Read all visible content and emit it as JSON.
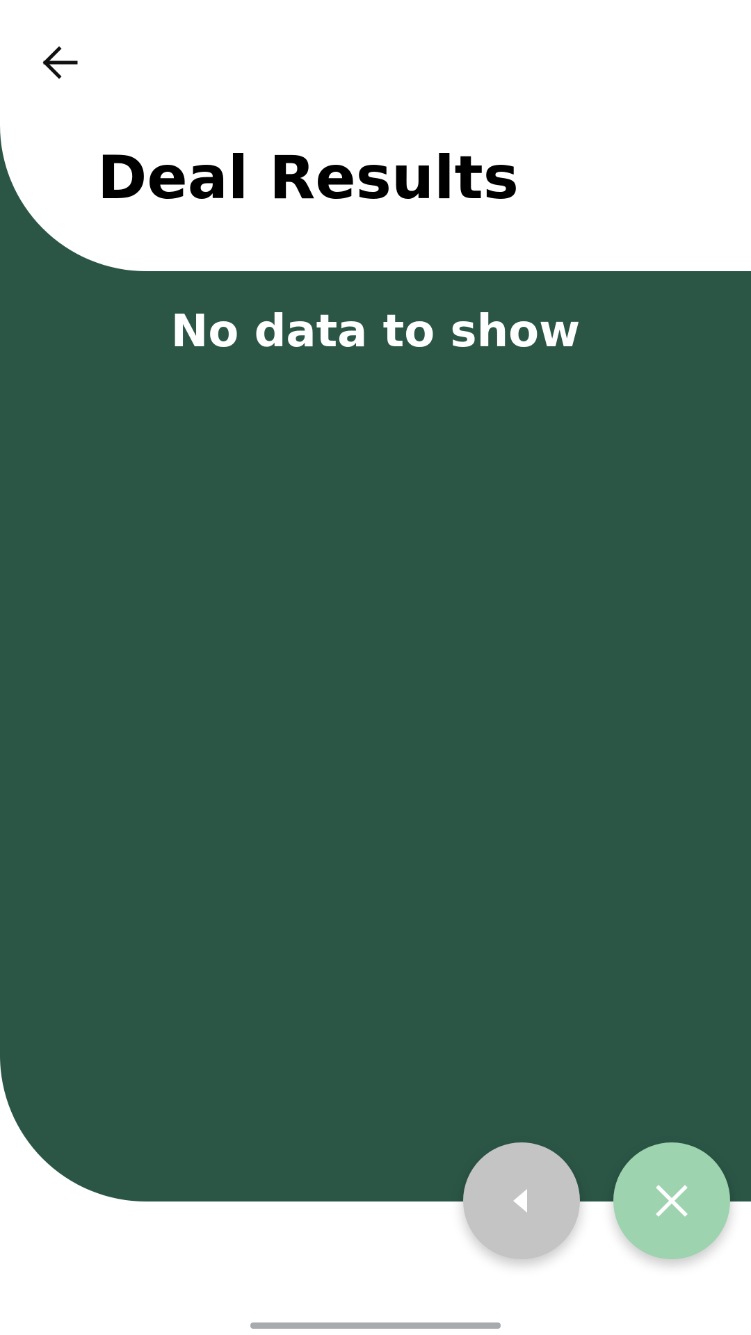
{
  "header": {
    "back_icon": "arrow-left-icon",
    "title": "Deal Results"
  },
  "main": {
    "empty_message": "No data to show"
  },
  "fabs": {
    "previous_icon": "caret-left-icon",
    "close_icon": "close-icon"
  },
  "colors": {
    "panel_background": "#2b5646",
    "previous_fab": "#c4c4c4",
    "close_fab": "#9dd3ae",
    "title_text": "#000000",
    "message_text": "#ffffff"
  }
}
